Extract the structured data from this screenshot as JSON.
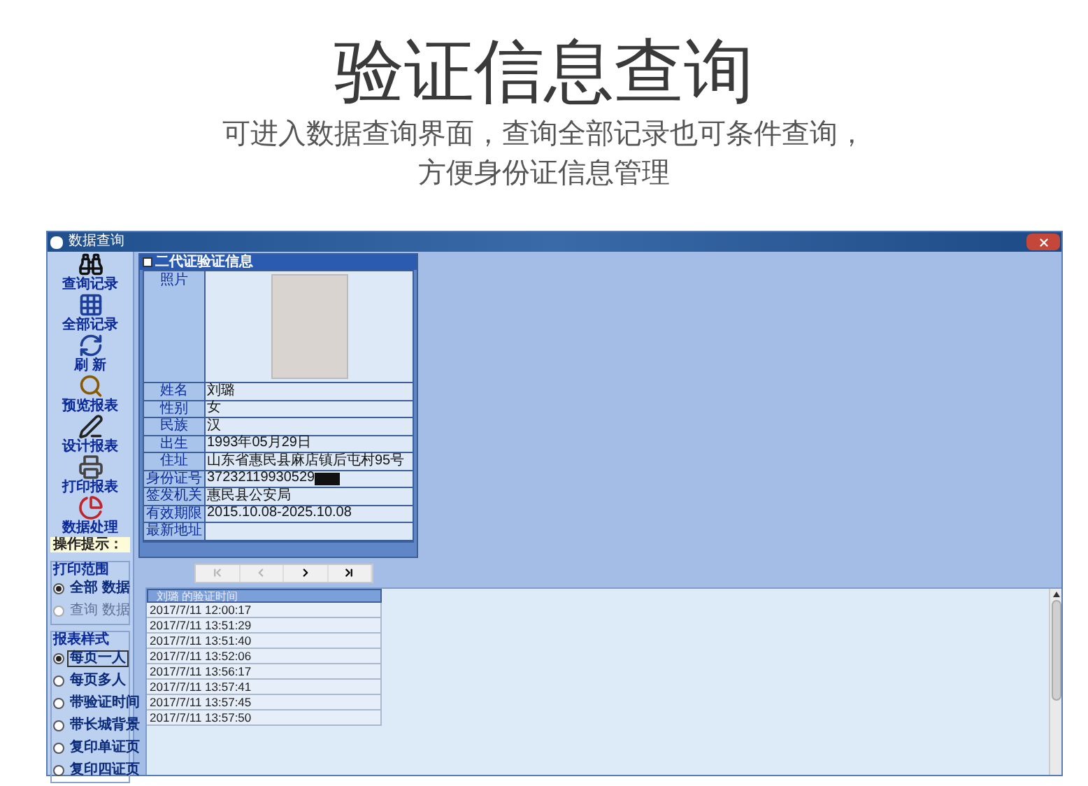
{
  "header": {
    "title": "验证信息查询",
    "subtitle_lines": [
      "可进入数据查询界面，查询全部记录也可条件查询，",
      "方便身份证信息管理"
    ]
  },
  "window": {
    "title": "数据查询"
  },
  "toolbar": [
    {
      "kind": "binoculars",
      "label": "查询记录"
    },
    {
      "kind": "grid",
      "label": "全部记录"
    },
    {
      "kind": "refresh",
      "label": "刷 新"
    },
    {
      "kind": "magnifier",
      "label": "预览报表"
    },
    {
      "kind": "pen",
      "label": "设计报表"
    },
    {
      "kind": "printer",
      "label": "打印报表"
    },
    {
      "kind": "pie",
      "label": "数据处理"
    }
  ],
  "hint": {
    "label": "操作提示："
  },
  "print_range": {
    "title": "打印范围",
    "options": [
      {
        "label": "全部 数据",
        "selected": true,
        "disabled": false
      },
      {
        "label": "查询 数据",
        "selected": false,
        "disabled": true
      }
    ]
  },
  "report_style": {
    "title": "报表样式",
    "options": [
      {
        "label": "每页一人",
        "selected": true
      },
      {
        "label": "每页多人",
        "selected": false
      },
      {
        "label": "带验证时间",
        "selected": false
      },
      {
        "label": "带长城背景",
        "selected": false
      },
      {
        "label": "复印单证页",
        "selected": false
      },
      {
        "label": "复印四证页",
        "selected": false
      }
    ]
  },
  "card": {
    "title": "二代证验证信息",
    "photo_label": "照片",
    "fields": [
      {
        "label": "姓名",
        "value": "刘璐"
      },
      {
        "label": "性别",
        "value": "女"
      },
      {
        "label": "民族",
        "value": "汉"
      },
      {
        "label": "出生",
        "value": "1993年05月29日"
      },
      {
        "label": "住址",
        "value": "山东省惠民县麻店镇后屯村95号"
      },
      {
        "label": "身份证号",
        "value": "37232119930529",
        "redacted": true
      },
      {
        "label": "签发机关",
        "value": "惠民县公安局"
      },
      {
        "label": "有效期限",
        "value": "2015.10.08-2025.10.08"
      },
      {
        "label": "最新地址"
      }
    ]
  },
  "nav": [
    {
      "kind": "first",
      "disabled": true
    },
    {
      "kind": "prev",
      "disabled": true
    },
    {
      "kind": "next",
      "disabled": false
    },
    {
      "kind": "last",
      "disabled": false
    }
  ],
  "list": {
    "column": "刘璐 的验证时间",
    "rows": [
      "2017/7/11 12:00:17",
      "2017/7/11 13:51:29",
      "2017/7/11 13:51:40",
      "2017/7/11 13:52:06",
      "2017/7/11 13:56:17",
      "2017/7/11 13:57:41",
      "2017/7/11 13:57:45",
      "2017/7/11 13:57:50"
    ]
  }
}
